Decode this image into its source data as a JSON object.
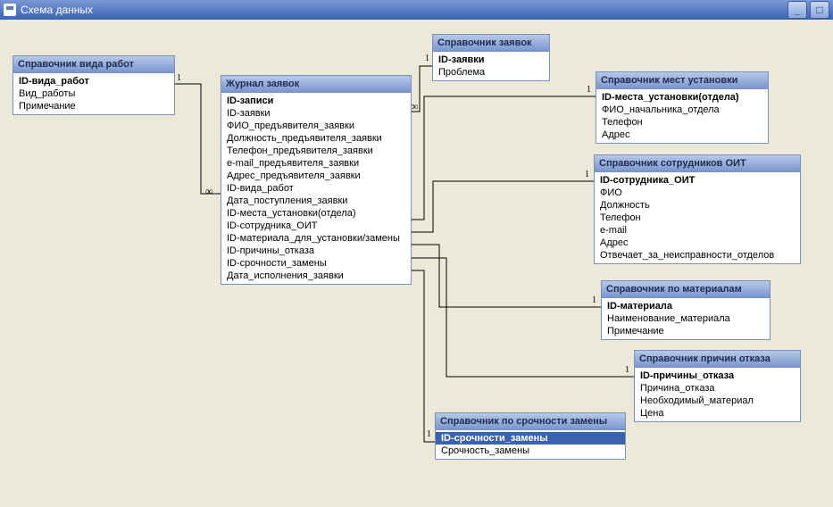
{
  "window": {
    "title": "Схема данных"
  },
  "tables": {
    "t1": {
      "title": "Справочник вида работ",
      "fields": [
        "ID-вида_работ",
        "Вид_работы",
        "Примечание"
      ],
      "selected": []
    },
    "t2": {
      "title": "Журнал заявок",
      "fields": [
        "ID-записи",
        "ID-заявки",
        "ФИО_предъявителя_заявки",
        "Должность_предъявителя_заявки",
        "Телефон_предъявителя_заявки",
        "e-mail_предъявителя_заявки",
        "Адрес_предъявителя_заявки",
        "ID-вида_работ",
        "Дата_поступления_заявки",
        "ID-места_установки(отдела)",
        "ID-сотрудника_ОИТ",
        "ID-материала_для_установки/замены",
        "ID-причины_отказа",
        "ID-срочности_замены",
        "Дата_исполнения_заявки"
      ],
      "selected": []
    },
    "t3": {
      "title": "Справочник заявок",
      "fields": [
        "ID-заявки",
        "Проблема"
      ],
      "selected": []
    },
    "t4": {
      "title": "Справочник мест установки",
      "fields": [
        "ID-места_установки(отдела)",
        "ФИО_начальника_отдела",
        "Телефон",
        "Адрес"
      ],
      "selected": []
    },
    "t5": {
      "title": "Справочник сотрудников ОИТ",
      "fields": [
        "ID-сотрудника_ОИТ",
        "ФИО",
        "Должность",
        "Телефон",
        "e-mail",
        "Адрес",
        "Отвечает_за_неисправности_отделов"
      ],
      "selected": []
    },
    "t6": {
      "title": "Справочник по материалам",
      "fields": [
        "ID-материала",
        "Наименование_материала",
        "Примечание"
      ],
      "selected": []
    },
    "t7": {
      "title": "Справочник причин отказа",
      "fields": [
        "ID-причины_отказа",
        "Причина_отказа",
        "Необходимый_материал",
        "Цена"
      ],
      "selected": []
    },
    "t8": {
      "title": "Справочник по срочности замены",
      "fields": [
        "ID-срочности_замены",
        "Срочность_замены"
      ],
      "selected": [
        0
      ]
    }
  },
  "labels": {
    "one": "1",
    "many": "∞"
  }
}
